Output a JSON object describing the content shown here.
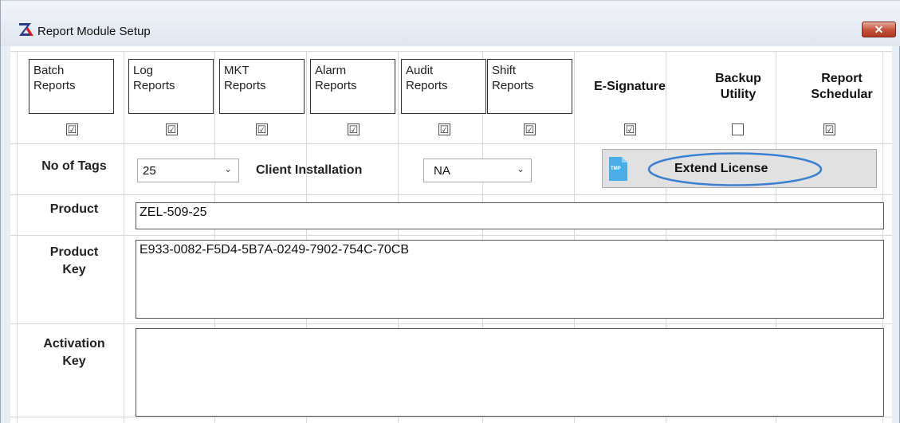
{
  "window": {
    "title": "Report Module Setup",
    "close_glyph": "✕"
  },
  "modules": [
    {
      "label": "Batch\nReports",
      "checked": true
    },
    {
      "label": "Log\nReports",
      "checked": true
    },
    {
      "label": "MKT\nReports",
      "checked": true
    },
    {
      "label": "Alarm\nReports",
      "checked": true
    },
    {
      "label": "Audit\nReports",
      "checked": true
    },
    {
      "label": "Shift\nReports",
      "checked": true
    },
    {
      "label": "E-Signature",
      "checked": true
    },
    {
      "label": "Backup\nUtility",
      "checked": false
    },
    {
      "label": "Report\nSchedular",
      "checked": true
    }
  ],
  "check_glyph": "☑",
  "tags": {
    "label": "No of Tags",
    "value": "25"
  },
  "client": {
    "label": "Client Installation",
    "value": "NA"
  },
  "extend": {
    "label": "Extend License",
    "icon": "tmp-file-icon",
    "icon_text": "TMP",
    "highlight_color": "#3a7fd0"
  },
  "product": {
    "label": "Product",
    "value": "ZEL-509-25"
  },
  "product_key": {
    "label": "Product\nKey",
    "value": "E933-0082-F5D4-5B7A-0249-7902-754C-70CB"
  },
  "activation_key": {
    "label": "Activation\nKey",
    "value": ""
  },
  "colors": {
    "close_button": "#c4503a",
    "titlebar": "#dfe6ef"
  }
}
